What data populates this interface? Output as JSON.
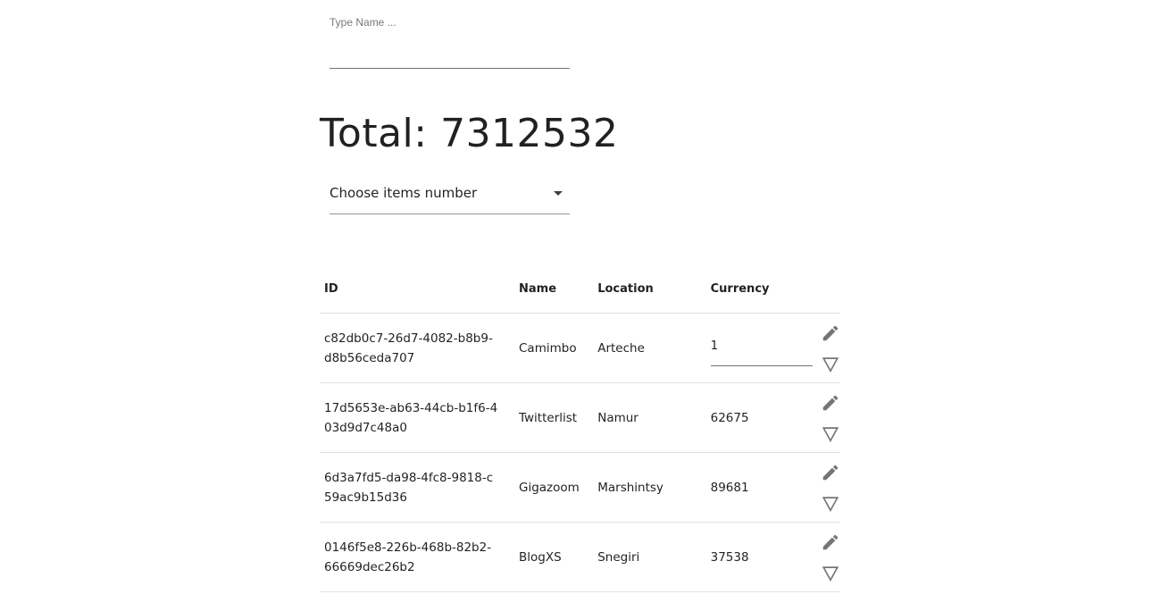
{
  "search": {
    "placeholder": "Type Name ...",
    "value": ""
  },
  "total": {
    "text": "Total: 7312532"
  },
  "items_select": {
    "label": "Choose items number"
  },
  "table": {
    "headers": {
      "id": "ID",
      "name": "Name",
      "location": "Location",
      "currency": "Currency"
    },
    "rows": [
      {
        "id": "c82db0c7-26d7-4082-b8b9-d8b56ceda707",
        "name": "Camimbo",
        "location": "Arteche",
        "currency": "1"
      },
      {
        "id": "17d5653e-ab63-44cb-b1f6-403d9d7c48a0",
        "name": "Twitterlist",
        "location": "Namur",
        "currency": "62675"
      },
      {
        "id": "6d3a7fd5-da98-4fc8-9818-c59ac9b15d36",
        "name": "Gigazoom",
        "location": "Marshintsy",
        "currency": "89681"
      },
      {
        "id": "0146f5e8-226b-468b-82b2-66669dec26b2",
        "name": "BlogXS",
        "location": "Snegiri",
        "currency": "37538"
      }
    ]
  },
  "icons": {
    "edit": "edit-pencil-icon",
    "filter": "filter-triangle-icon",
    "dropdown": "arrow-drop-down-icon"
  },
  "colors": {
    "icon": "#757575",
    "divider": "#e0e0e0",
    "text": "#212121"
  }
}
